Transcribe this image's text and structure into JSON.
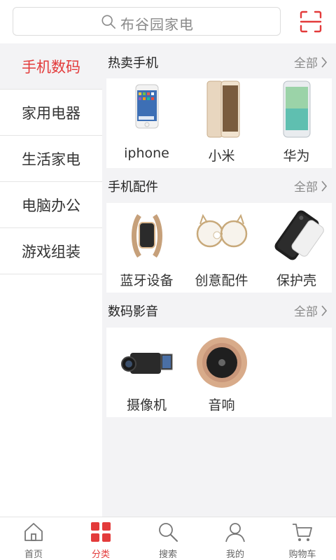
{
  "search": {
    "placeholder": "布谷园家电",
    "icon": "search-icon"
  },
  "scan": {
    "icon": "scan-icon",
    "color": "#e33b3b"
  },
  "sidebar": {
    "items": [
      {
        "label": "手机数码",
        "active": true
      },
      {
        "label": "家用电器"
      },
      {
        "label": "生活家电"
      },
      {
        "label": "电脑办公"
      },
      {
        "label": "游戏组装"
      }
    ]
  },
  "sections": [
    {
      "title": "热卖手机",
      "more": "全部",
      "items": [
        {
          "label": "iphone",
          "icon": "iphone-image"
        },
        {
          "label": "小米",
          "icon": "xiaomi-phone-image"
        },
        {
          "label": "华为",
          "icon": "huawei-phone-image"
        }
      ]
    },
    {
      "title": "手机配件",
      "more": "全部",
      "items": [
        {
          "label": "蓝牙设备",
          "icon": "smart-band-image"
        },
        {
          "label": "创意配件",
          "icon": "cat-glasses-stand-image"
        },
        {
          "label": "保护壳",
          "icon": "phone-case-image"
        }
      ]
    },
    {
      "title": "数码影音",
      "more": "全部",
      "items": [
        {
          "label": "摄像机",
          "icon": "camcorder-image"
        },
        {
          "label": "音响",
          "icon": "speaker-image"
        }
      ]
    }
  ],
  "tabbar": {
    "tabs": [
      {
        "label": "首页",
        "icon": "home-icon"
      },
      {
        "label": "分类",
        "icon": "category-icon",
        "active": true
      },
      {
        "label": "搜索",
        "icon": "search-icon"
      },
      {
        "label": "我的",
        "icon": "user-icon"
      },
      {
        "label": "购物车",
        "icon": "cart-icon"
      }
    ]
  },
  "colors": {
    "accent": "#e33b3b",
    "background": "#f3f3f5",
    "text": "#333333",
    "muted": "#8a8a8a"
  }
}
